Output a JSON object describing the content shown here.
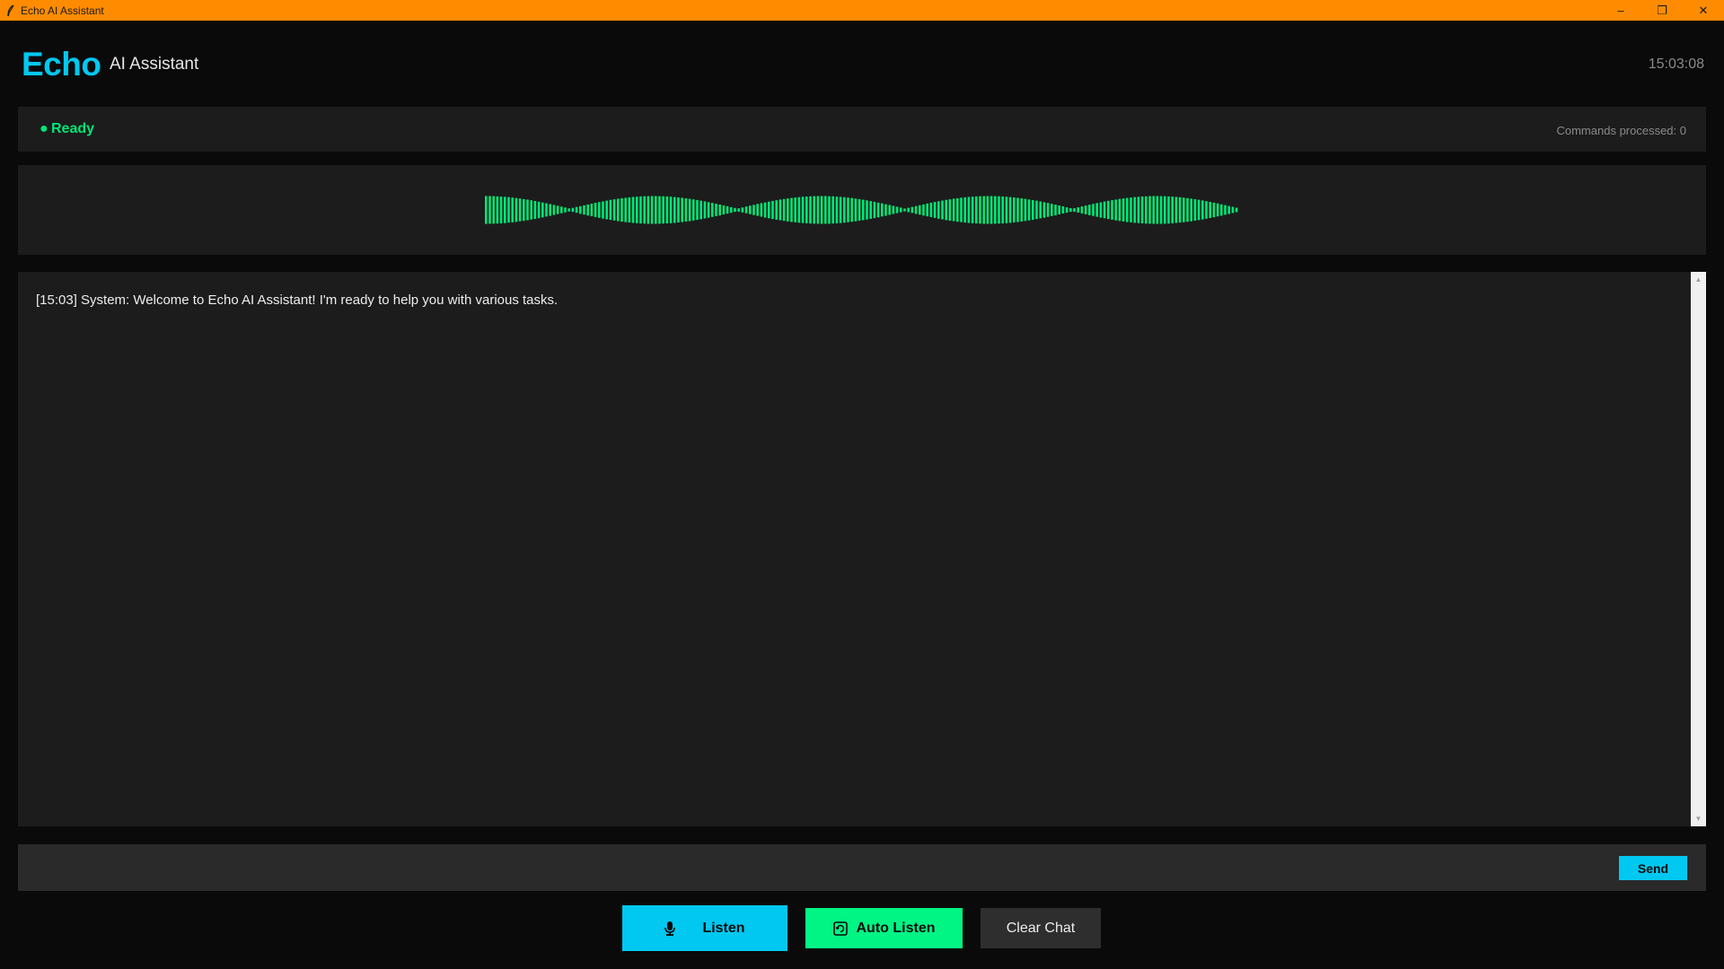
{
  "window": {
    "title": "Echo AI Assistant",
    "controls": {
      "minimize": "–",
      "restore": "❐",
      "close": "✕"
    }
  },
  "header": {
    "logo": "Echo",
    "subtitle": "AI Assistant",
    "time": "15:03:08"
  },
  "status": {
    "dot": "●",
    "text": "Ready",
    "commands_label": "Commands processed: 0",
    "color": "#00e676"
  },
  "visualizer": {
    "bar_color": "#00e676"
  },
  "chat": {
    "messages": [
      {
        "text": "[15:03] System: Welcome to Echo AI Assistant! I'm ready to help you with various tasks."
      }
    ]
  },
  "input": {
    "placeholder": "",
    "value": "",
    "send_label": "Send"
  },
  "buttons": {
    "listen": {
      "label": "Listen",
      "icon": "microphone-icon"
    },
    "auto_listen": {
      "label": "Auto Listen",
      "icon": "auto-listen-icon"
    },
    "clear": {
      "label": "Clear Chat"
    }
  },
  "colors": {
    "accent": "#00c8f0",
    "green": "#00f585",
    "titlebar": "#ff8c00",
    "background": "#0a0a0a",
    "panel": "#1c1c1c"
  }
}
